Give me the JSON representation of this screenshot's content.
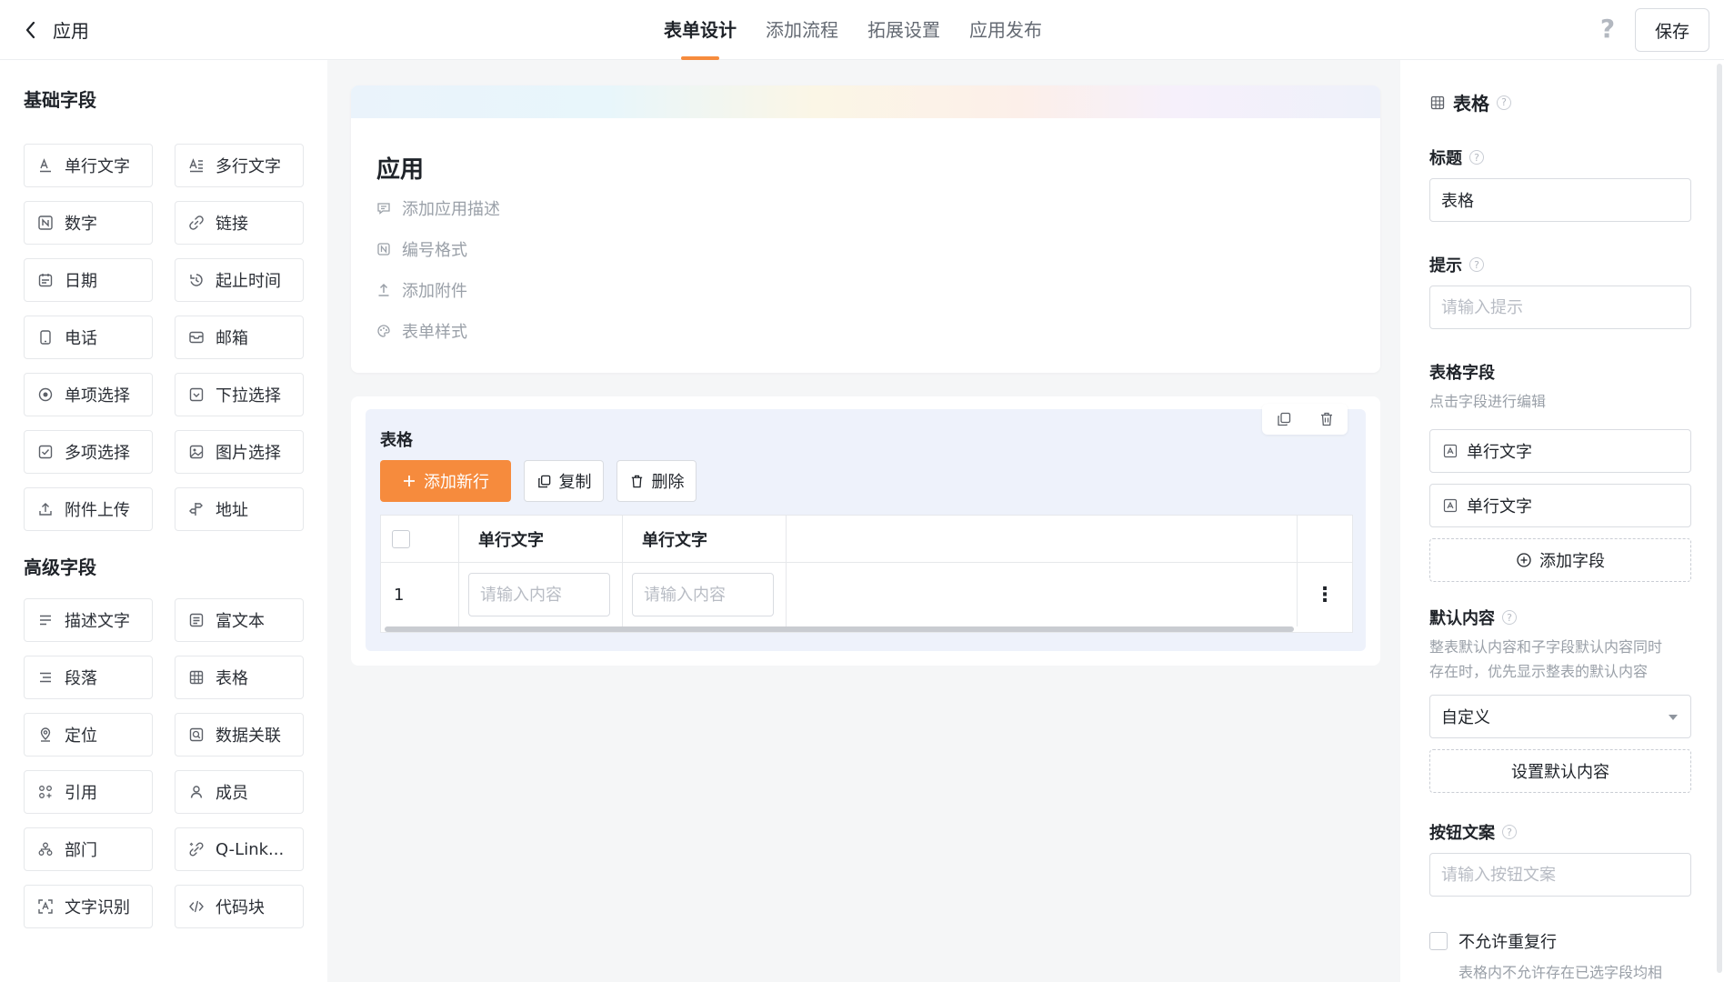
{
  "header": {
    "back_label": "应用",
    "tabs": [
      {
        "label": "表单设计",
        "active": true
      },
      {
        "label": "添加流程"
      },
      {
        "label": "拓展设置"
      },
      {
        "label": "应用发布"
      }
    ],
    "help_glyph": "?",
    "save_label": "保存"
  },
  "palette": {
    "basic_title": "基础字段",
    "basic_fields": [
      {
        "label": "单行文字",
        "icon": "text-line-icon"
      },
      {
        "label": "多行文字",
        "icon": "text-multiline-icon"
      },
      {
        "label": "数字",
        "icon": "number-icon"
      },
      {
        "label": "链接",
        "icon": "link-icon"
      },
      {
        "label": "日期",
        "icon": "calendar-icon"
      },
      {
        "label": "起止时间",
        "icon": "time-range-icon"
      },
      {
        "label": "电话",
        "icon": "phone-icon"
      },
      {
        "label": "邮箱",
        "icon": "mail-icon"
      },
      {
        "label": "单项选择",
        "icon": "radio-icon"
      },
      {
        "label": "下拉选择",
        "icon": "dropdown-icon"
      },
      {
        "label": "多项选择",
        "icon": "checkbox-icon"
      },
      {
        "label": "图片选择",
        "icon": "image-icon"
      },
      {
        "label": "附件上传",
        "icon": "upload-icon"
      },
      {
        "label": "地址",
        "icon": "address-icon"
      }
    ],
    "advanced_title": "高级字段",
    "advanced_fields": [
      {
        "label": "描述文字",
        "icon": "description-icon"
      },
      {
        "label": "富文本",
        "icon": "rich-text-icon"
      },
      {
        "label": "段落",
        "icon": "paragraph-icon"
      },
      {
        "label": "表格",
        "icon": "table-icon"
      },
      {
        "label": "定位",
        "icon": "location-icon"
      },
      {
        "label": "数据关联",
        "icon": "data-link-icon"
      },
      {
        "label": "引用",
        "icon": "reference-icon"
      },
      {
        "label": "成员",
        "icon": "member-icon"
      },
      {
        "label": "部门",
        "icon": "department-icon"
      },
      {
        "label": "Q-Link...",
        "icon": "qlink-icon"
      },
      {
        "label": "文字识别",
        "icon": "ocr-icon"
      },
      {
        "label": "代码块",
        "icon": "code-icon"
      }
    ]
  },
  "canvas": {
    "app_title": "应用",
    "app_actions": [
      {
        "label": "添加应用描述",
        "icon": "comment-icon"
      },
      {
        "label": "编号格式",
        "icon": "number-format-icon"
      },
      {
        "label": "添加附件",
        "icon": "attach-upload-icon"
      },
      {
        "label": "表单样式",
        "icon": "palette-icon"
      }
    ],
    "table": {
      "title": "表格",
      "add_row_label": "添加新行",
      "copy_label": "复制",
      "delete_label": "删除",
      "columns": [
        "单行文字",
        "单行文字"
      ],
      "rows": [
        {
          "index": "1",
          "placeholders": [
            "请输入内容",
            "请输入内容"
          ]
        }
      ],
      "more_glyph": "⋮"
    }
  },
  "props": {
    "component_title": "表格",
    "title_label": "标题",
    "title_value": "表格",
    "hint_label": "提示",
    "hint_placeholder": "请输入提示",
    "fields_label": "表格字段",
    "fields_hint": "点击字段进行编辑",
    "sub_fields": [
      "单行文字",
      "单行文字"
    ],
    "add_field_label": "添加字段",
    "default_label": "默认内容",
    "default_hint_1": "整表默认内容和子字段默认内容同时",
    "default_hint_2": "存在时，优先显示整表的默认内容",
    "default_select_value": "自定义",
    "set_default_label": "设置默认内容",
    "button_text_label": "按钮文案",
    "button_text_placeholder": "请输入按钮文案",
    "no_duplicate_label": "不允许重复行",
    "no_duplicate_hint": "表格内不允许存在已选字段均相"
  },
  "colors": {
    "accent": "#f68b3d",
    "table_bg": "#eef2fb",
    "canvas_bg": "#f5f6f7"
  }
}
